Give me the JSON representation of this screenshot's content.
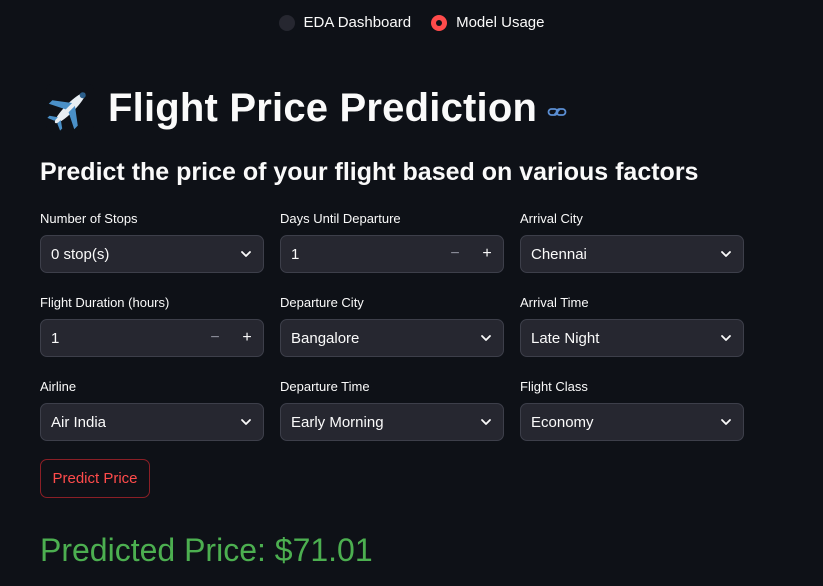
{
  "nav": {
    "options": [
      {
        "label": "EDA Dashboard",
        "selected": false
      },
      {
        "label": "Model Usage",
        "selected": true
      }
    ]
  },
  "header": {
    "icon": "airplane-emoji",
    "title": "Flight Price Prediction",
    "link_icon": "link-icon"
  },
  "subtitle": "Predict the price of your flight based on various factors",
  "form": {
    "stops": {
      "label": "Number of Stops",
      "value": "0 stop(s)"
    },
    "days_until_departure": {
      "label": "Days Until Departure",
      "value": "1"
    },
    "arrival_city": {
      "label": "Arrival City",
      "value": "Chennai"
    },
    "duration": {
      "label": "Flight Duration (hours)",
      "value": "1"
    },
    "departure_city": {
      "label": "Departure City",
      "value": "Bangalore"
    },
    "arrival_time": {
      "label": "Arrival Time",
      "value": "Late Night"
    },
    "airline": {
      "label": "Airline",
      "value": "Air India"
    },
    "departure_time": {
      "label": "Departure Time",
      "value": "Early Morning"
    },
    "flight_class": {
      "label": "Flight Class",
      "value": "Economy"
    },
    "minus": "−",
    "plus": "+"
  },
  "predict_button": "Predict Price",
  "result": "Predicted Price: $71.01",
  "colors": {
    "background": "#0e1117",
    "accent": "#ff4b4b",
    "result": "#4caf50",
    "control": "#262730"
  }
}
